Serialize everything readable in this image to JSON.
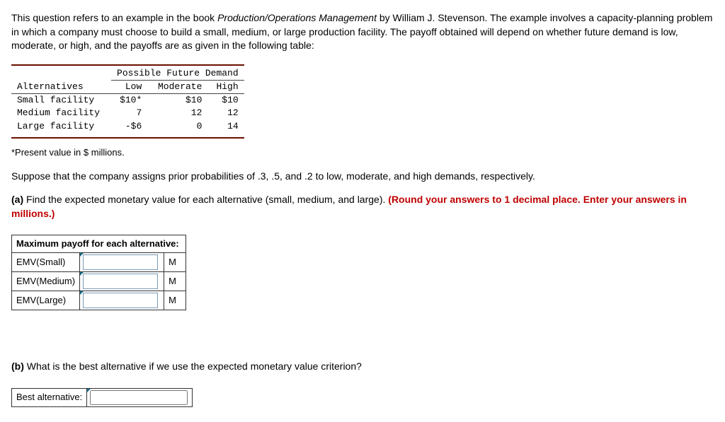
{
  "intro": {
    "text_before_italic": "This question refers to an example in the book ",
    "italic": "Production/Operations Management",
    "text_after_italic": " by William J. Stevenson. The example involves a capacity-planning problem in which a company must choose to build a small, medium, or large production facility. The payoff obtained will depend on whether future demand is low, moderate, or high, and the payoffs are as given in the following table:"
  },
  "payoff": {
    "header_group": "Possible Future Demand",
    "col0": "Alternatives",
    "col1": "Low",
    "col2": "Moderate",
    "col3": "High",
    "rows": [
      {
        "label": "Small facility",
        "low": "$10*",
        "mod": "$10",
        "high": "$10"
      },
      {
        "label": "Medium facility",
        "low": "7",
        "mod": "12",
        "high": "12"
      },
      {
        "label": "Large facility",
        "low": "-$6",
        "mod": "0",
        "high": "14"
      }
    ]
  },
  "footnote": "*Present value in $ millions.",
  "prob_line": "Suppose that the company assigns prior probabilities of .3, .5, and .2 to low, moderate, and high demands, respectively.",
  "part_a": {
    "label": "(a)",
    "text": " Find the expected monetary value for each alternative (small, medium, and large). ",
    "red": "(Round your answers to 1 decimal place. Enter your answers in millions.)"
  },
  "emv_table": {
    "title": "Maximum payoff for each alternative:",
    "rows": [
      {
        "label": "EMV(Small)",
        "unit": "M"
      },
      {
        "label": "EMV(Medium)",
        "unit": "M"
      },
      {
        "label": "EMV(Large)",
        "unit": "M"
      }
    ]
  },
  "part_b": {
    "label": "(b)",
    "text": " What is the best alternative if we use the expected monetary value criterion?"
  },
  "best_alt_label": "Best alternative:"
}
